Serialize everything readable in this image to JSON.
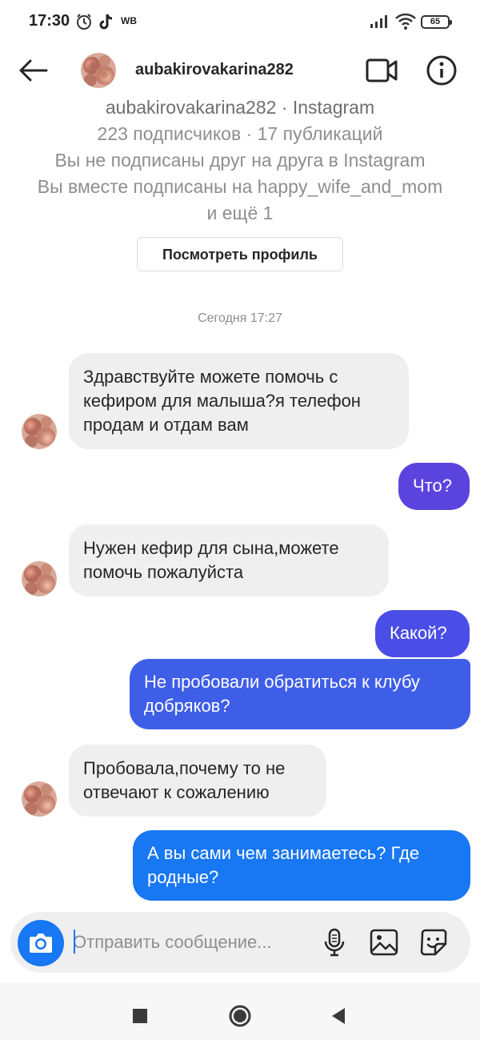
{
  "status_bar": {
    "time": "17:30",
    "carrier_badge": "WB",
    "battery": "65",
    "icons": [
      "alarm-icon",
      "tiktok-icon",
      "signal-icon",
      "wifi-icon",
      "battery-icon"
    ]
  },
  "header": {
    "username": "aubakirovakarina282",
    "icons": [
      "back-arrow-icon",
      "video-call-icon",
      "info-icon"
    ]
  },
  "profile": {
    "line1": "aubakirovakarina282 · Instagram",
    "line2": "223 подписчиков · 17 публикаций",
    "line3": "Вы не подписаны друг на друга в Instagram",
    "line4": "Вы вместе подписаны на happy_wife_and_mom",
    "line5": "и ещё 1",
    "view_profile_label": "Посмотреть профиль"
  },
  "timestamp": "Сегодня 17:27",
  "colors": {
    "incoming_bubble": "#efefef",
    "outgoing_purple": "#5b44de",
    "outgoing_violet": "#4a4ee6",
    "outgoing_indigo": "#3f5ee8",
    "outgoing_blue": "#1877f2",
    "accent": "#1877f2"
  },
  "messages": [
    {
      "direction": "in",
      "text": "Здравствуйте можете помочь с кефиром для малыша?я телефон продам и отдам вам"
    },
    {
      "direction": "out",
      "text": "Что?"
    },
    {
      "direction": "in",
      "text": "Нужен кефир для сына,можете помочь пожалуйста"
    },
    {
      "direction": "out",
      "text": "Какой?"
    },
    {
      "direction": "out",
      "text": "Не пробовали обратиться к клубу добряков?"
    },
    {
      "direction": "in",
      "text": "Пробовала,почему то не отвечают к сожалению"
    },
    {
      "direction": "out",
      "text": "А вы сами чем занимаетесь? Где родные?"
    }
  ],
  "composer": {
    "placeholder": "Отправить сообщение...",
    "icons": [
      "camera-icon",
      "microphone-icon",
      "gallery-icon",
      "sticker-icon"
    ]
  },
  "nav_bar": {
    "icons": [
      "recents-square-icon",
      "home-circle-icon",
      "back-triangle-icon"
    ]
  }
}
